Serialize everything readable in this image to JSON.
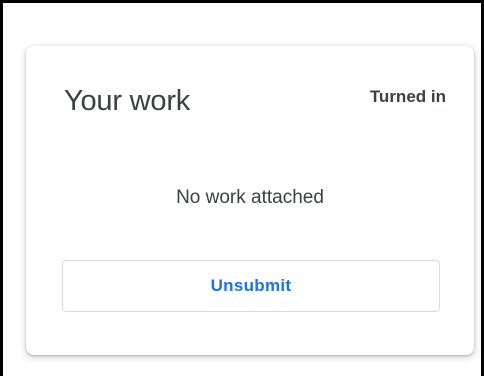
{
  "card": {
    "title": "Your work",
    "status": "Turned in",
    "empty_message": "No work attached",
    "unsubmit_label": "Unsubmit"
  },
  "colors": {
    "text": "#3c4043",
    "accent": "#1a73e8",
    "button_border": "#dadce0"
  }
}
